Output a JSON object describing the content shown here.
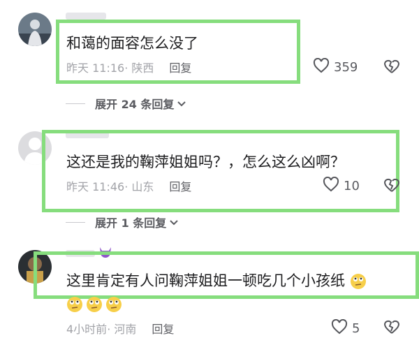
{
  "comments": [
    {
      "text": "和蔼的面容怎么没了",
      "time": "昨天 11:16",
      "sep": "·",
      "location": "陕西",
      "reply": "回复",
      "likes": "359",
      "expand": "展开 24 条回复"
    },
    {
      "text": "这还是我的鞠萍姐姐吗？，怎么这么凶啊？",
      "time": "昨天 11:46",
      "sep": "·",
      "location": "山东",
      "reply": "回复",
      "likes": "10",
      "expand": "展开 1 条回复"
    },
    {
      "text": "这里肯定有人问鞠萍姐姐一顿吃几个小孩纸",
      "time": "4小时前",
      "sep": "·",
      "location": "河南",
      "reply": "回复",
      "likes": "5"
    }
  ],
  "icons": {
    "like": "heart-icon",
    "dislike": "broken-heart-icon",
    "expand": "chevron-down-icon",
    "emoji": "rolling-eyes-emoji"
  },
  "colors": {
    "highlight": "#86dd7d",
    "meta": "#a2a3a8",
    "text": "#1d1d1f"
  }
}
